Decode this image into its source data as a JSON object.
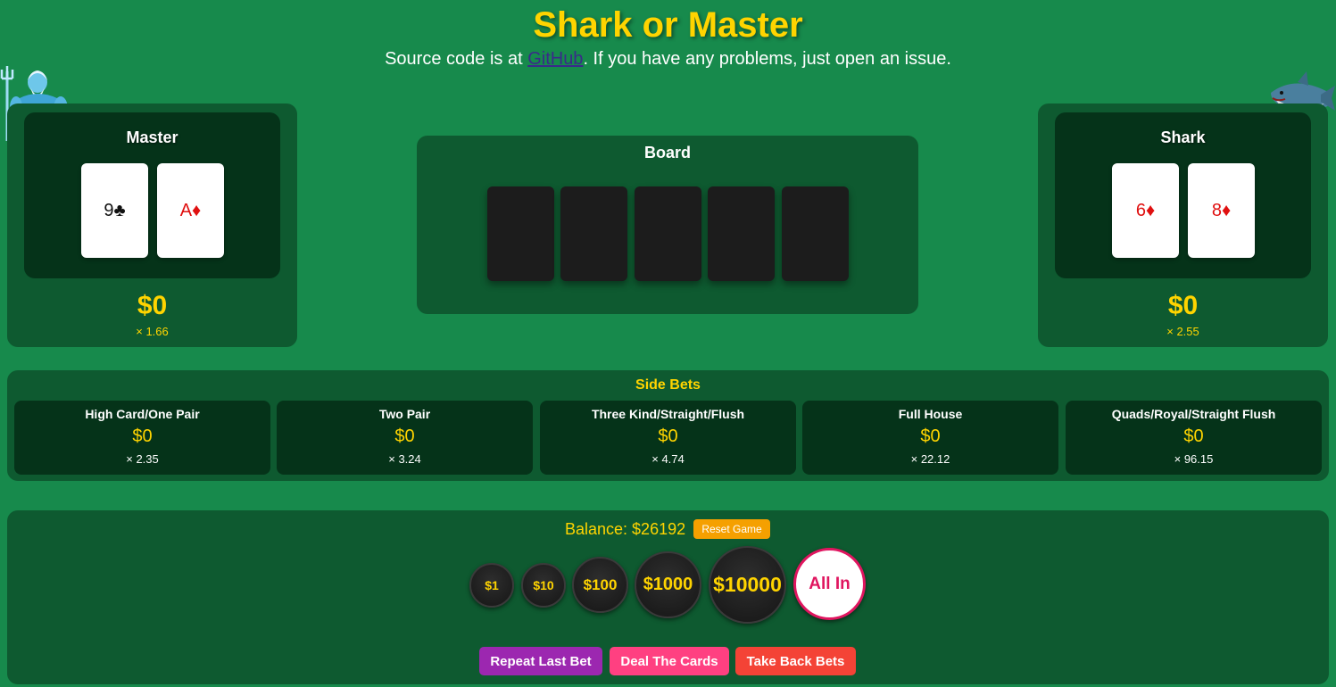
{
  "header": {
    "title": "Shark or Master",
    "subtitle_prefix": "Source code is at ",
    "github_link": "GitHub",
    "subtitle_suffix": ". If you have any problems, just open an issue."
  },
  "master": {
    "name": "Master",
    "cards": [
      {
        "label": "9♣",
        "color": "black"
      },
      {
        "label": "A♦",
        "color": "red"
      }
    ],
    "amount": "$0",
    "multiplier": "× 1.66"
  },
  "shark": {
    "name": "Shark",
    "cards": [
      {
        "label": "6♦",
        "color": "red"
      },
      {
        "label": "8♦",
        "color": "red"
      }
    ],
    "amount": "$0",
    "multiplier": "× 2.55"
  },
  "board": {
    "title": "Board",
    "card_count": 5
  },
  "side_bets": {
    "title": "Side Bets",
    "items": [
      {
        "label": "High Card/One Pair",
        "amount": "$0",
        "multiplier": "× 2.35"
      },
      {
        "label": "Two Pair",
        "amount": "$0",
        "multiplier": "× 3.24"
      },
      {
        "label": "Three Kind/Straight/Flush",
        "amount": "$0",
        "multiplier": "× 4.74"
      },
      {
        "label": "Full House",
        "amount": "$0",
        "multiplier": "× 22.12"
      },
      {
        "label": "Quads/Royal/Straight Flush",
        "amount": "$0",
        "multiplier": "× 96.15"
      }
    ]
  },
  "controls": {
    "balance": "Balance: $26192",
    "reset_label": "Reset Game",
    "chips": [
      "$1",
      "$10",
      "$100",
      "$1000",
      "$10000",
      "All In"
    ],
    "actions": [
      {
        "label": "Repeat Last Bet",
        "color": "#9c27b0"
      },
      {
        "label": "Deal The Cards",
        "color": "#ff4081"
      },
      {
        "label": "Take Back Bets",
        "color": "#f44336"
      }
    ]
  },
  "colors": {
    "background": "#178a4c",
    "panel": "#0e5a30",
    "inner_panel": "#053319",
    "accent_gold": "#ffd400"
  }
}
